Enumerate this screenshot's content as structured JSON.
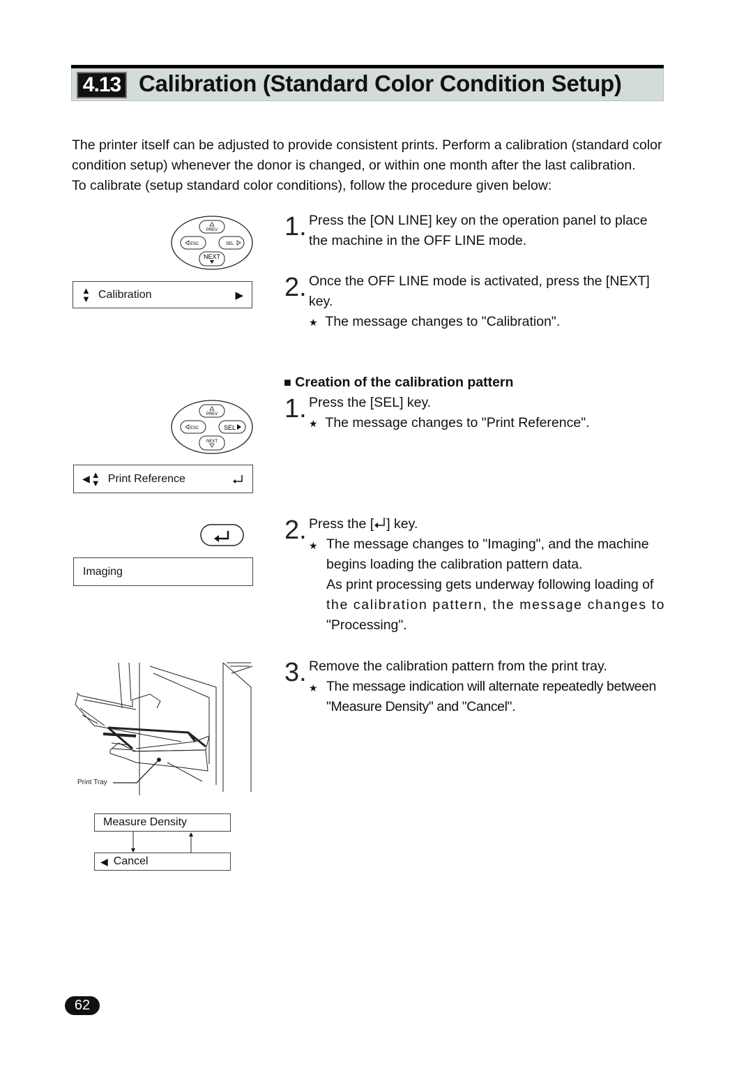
{
  "header": {
    "section_number": "4.13",
    "title": "Calibration (Standard Color Condition Setup)"
  },
  "intro": [
    "The printer itself can be adjusted to provide consistent prints. Perform a calibration (standard color",
    "condition setup) whenever the donor is changed, or within one month after the last calibration.",
    "To calibrate (setup standard color conditions), follow the procedure given below:"
  ],
  "keypad": {
    "prev": "PREV",
    "esc": "ESC",
    "sel": "SEL",
    "next": "NEXT"
  },
  "displays": {
    "calibration": "Calibration",
    "print_reference": "Print Reference",
    "imaging": "Imaging",
    "measure_density": "Measure Density",
    "cancel": "Cancel"
  },
  "illustration": {
    "label": "Print Tray"
  },
  "steps_a": [
    {
      "num": "1.",
      "lines": [
        "Press the [ON LINE] key on the operation panel to place",
        "the machine in the OFF LINE mode."
      ]
    },
    {
      "num": "2.",
      "lines": [
        "Once the OFF LINE mode is activated, press the [NEXT]",
        "key."
      ],
      "note": "The message changes to \"Calibration\"."
    }
  ],
  "section2": {
    "heading": "Creation of the calibration pattern"
  },
  "steps_b": [
    {
      "num": "1.",
      "line": "Press the [SEL] key.",
      "note": "The message changes to \"Print Reference\"."
    },
    {
      "num": "2.",
      "line_pre": "Press the [",
      "line_post": "] key.",
      "notes": [
        "The message changes to \"Imaging\", and the machine",
        "begins loading the calibration pattern data.",
        "As print processing gets underway following loading of",
        "the calibration pattern, the message changes to",
        "\"Processing\"."
      ]
    },
    {
      "num": "3.",
      "line": "Remove the calibration pattern from the print tray.",
      "notes": [
        "The message indication will alternate repeatedly between",
        "\"Measure Density\" and \"Cancel\"."
      ]
    }
  ],
  "page_number": "62"
}
